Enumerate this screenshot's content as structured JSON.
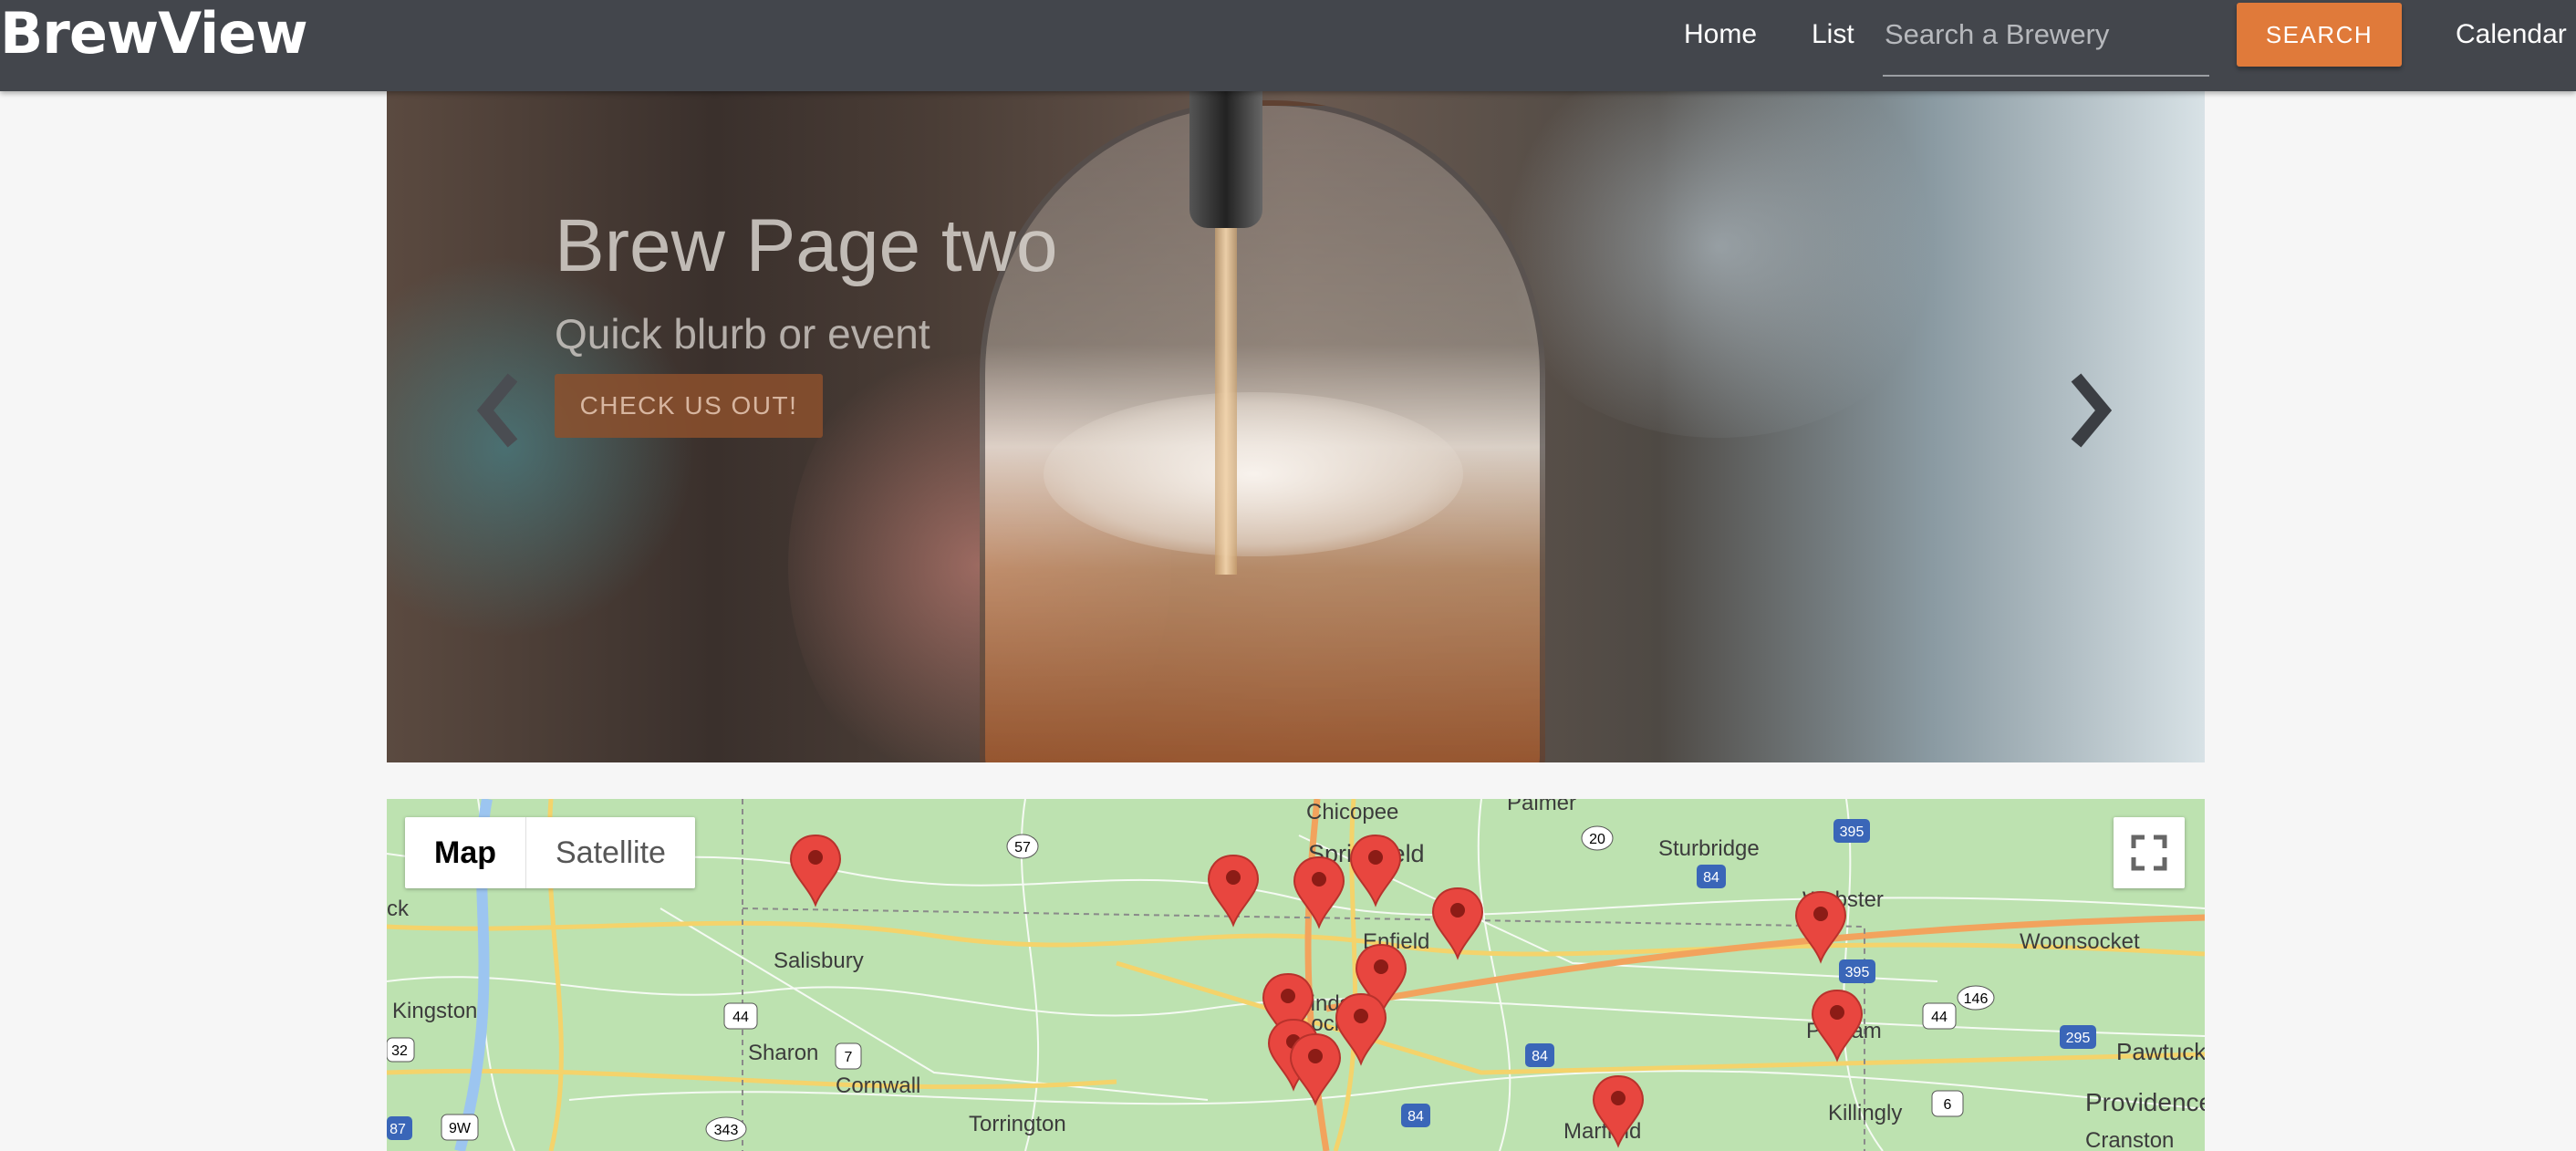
{
  "navbar": {
    "brand": "BrewView",
    "links": {
      "home": "Home",
      "list": "List",
      "calendar": "Calendar"
    },
    "search": {
      "placeholder": "Search a Brewery",
      "value": "",
      "button_label": "SEARCH"
    }
  },
  "carousel": {
    "title": "Brew Page two",
    "subtitle": "Quick blurb or event",
    "cta_label": "CHECK US OUT!",
    "prev_icon": "chevron-left-icon",
    "next_icon": "chevron-right-icon"
  },
  "map": {
    "type_controls": {
      "map": "Map",
      "satellite": "Satellite",
      "selected": "Map"
    },
    "fullscreen_icon": "fullscreen-icon",
    "places": [
      "Chicopee",
      "Palmer",
      "Springfield",
      "Sturbridge",
      "Webster",
      "Woonsocket",
      "Salisbury",
      "Enfield",
      "Windsor Locks",
      "Putnam",
      "Kingston",
      "Sharon",
      "Cornwall",
      "Torrington",
      "Pawtuck",
      "Providence",
      "Cranston",
      "Killingly",
      "Marfield",
      "ck"
    ],
    "route_shields": [
      "57",
      "20",
      "395",
      "84",
      "57",
      "395",
      "146",
      "44",
      "44",
      "295",
      "32",
      "7",
      "84",
      "6",
      "87",
      "9W",
      "343",
      "84"
    ],
    "colors": {
      "land": "#b9dfad",
      "marker": "#e8463f",
      "marker_dot": "#8c1c16"
    }
  },
  "colors": {
    "navbar": "#43464c",
    "accent": "#e07a3a",
    "background": "#f6f6f6"
  }
}
